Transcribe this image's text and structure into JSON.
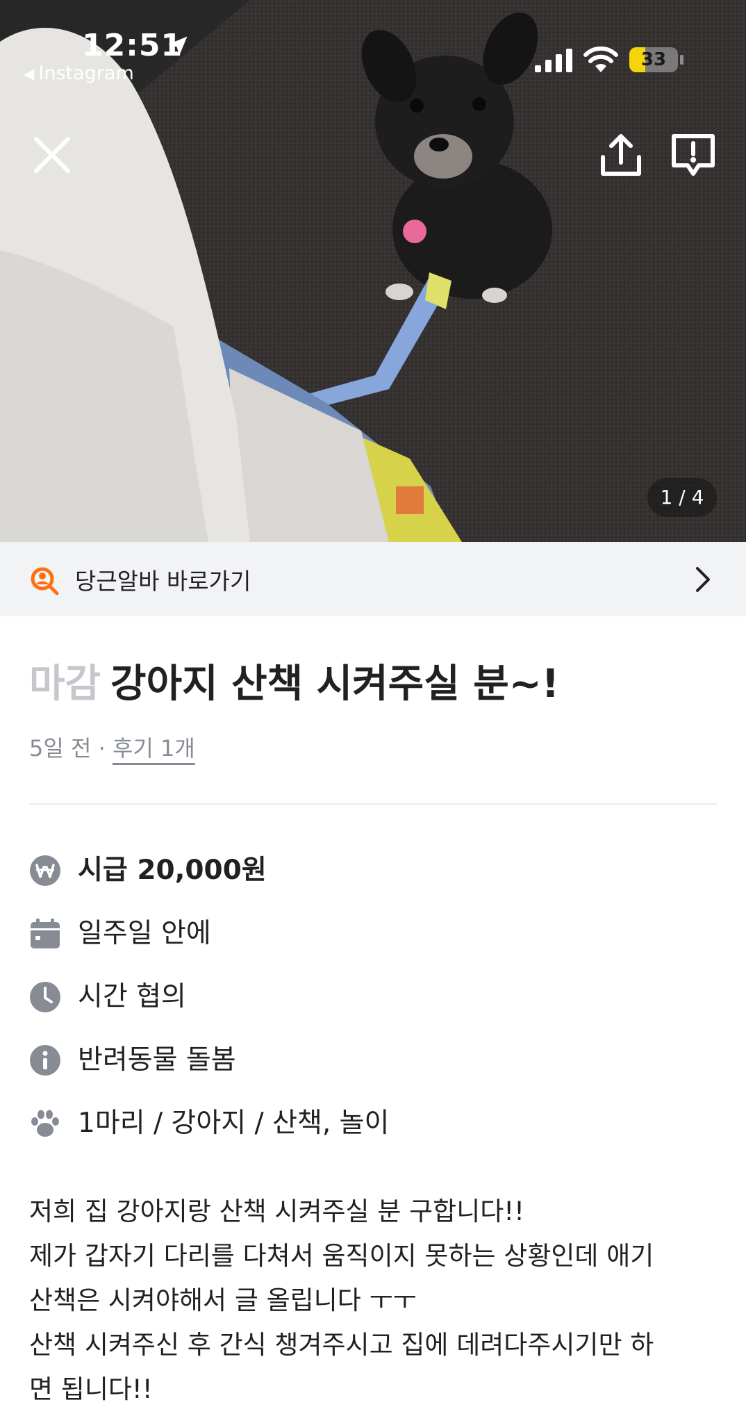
{
  "status_bar": {
    "time": "12:51",
    "back_app": "Instagram",
    "battery": "33",
    "battery_level": 0.33
  },
  "gallery": {
    "page_indicator": "1 / 4"
  },
  "banner": {
    "label": "당근알바 바로가기"
  },
  "post": {
    "status": "마감",
    "title": "강아지 산책 시켜주실 분~!",
    "time_ago": "5일 전",
    "separator": " · ",
    "review": "후기 1개"
  },
  "details": {
    "wage": "시급 20,000원",
    "schedule": "일주일 안에",
    "time": "시간 협의",
    "category": "반려동물 돌봄",
    "pet": "1마리 / 강아지 / 산책, 놀이"
  },
  "description": [
    "저희 집 강아지랑 산책 시켜주실 분 구합니다!!",
    "제가 갑자기 다리를 다쳐서 움직이지 못하는 상황인데 애기",
    "산책은 시켜야해서 글 올립니다 ㅜㅜ",
    "산책 시켜주신 후 간식 챙겨주시고 집에 데려다주시기만 하",
    "면 됩니다!!"
  ],
  "colors": {
    "brand_orange": "#ff6f0f",
    "closed_status": "#c5c7cc",
    "icon_gray": "#868b94",
    "banner_bg": "#f2f3f5"
  },
  "icons": {
    "wage": "won-icon",
    "schedule": "calendar-icon",
    "time": "clock-icon",
    "category": "info-icon",
    "pet": "paw-icon"
  }
}
